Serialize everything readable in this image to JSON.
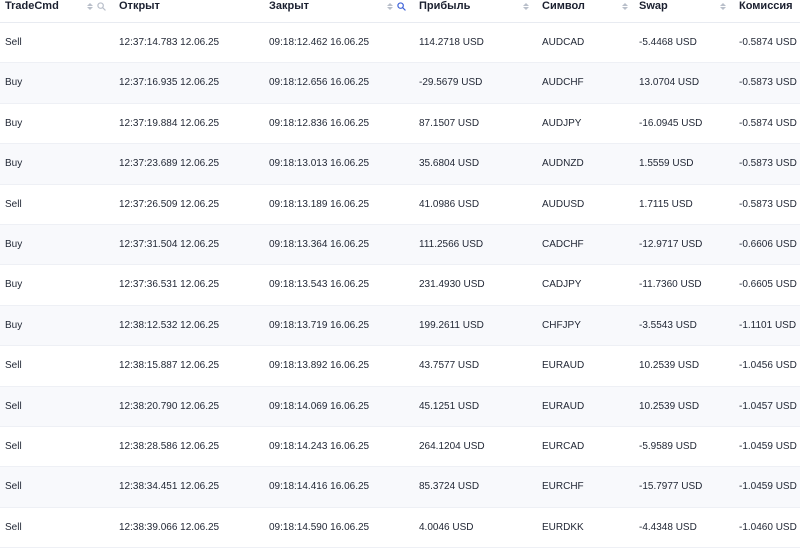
{
  "table": {
    "columns": [
      {
        "label": "TradeCmd",
        "sortable": true,
        "searchable": true,
        "search_active": false
      },
      {
        "label": "Открыт",
        "sortable": false,
        "searchable": false,
        "search_active": false
      },
      {
        "label": "Закрыт",
        "sortable": true,
        "searchable": true,
        "search_active": true
      },
      {
        "label": "Прибыль",
        "sortable": true,
        "searchable": false,
        "search_active": false
      },
      {
        "label": "Символ",
        "sortable": true,
        "searchable": false,
        "search_active": false
      },
      {
        "label": "Swap",
        "sortable": true,
        "searchable": false,
        "search_active": false
      },
      {
        "label": "Комиссия",
        "sortable": true,
        "searchable": false,
        "search_active": false
      }
    ],
    "rows": [
      [
        "Sell",
        "12:37:14.783 12.06.25",
        "09:18:12.462 16.06.25",
        "114.2718 USD",
        "AUDCAD",
        "-5.4468 USD",
        "-0.5874 USD"
      ],
      [
        "Buy",
        "12:37:16.935 12.06.25",
        "09:18:12.656 16.06.25",
        "-29.5679 USD",
        "AUDCHF",
        "13.0704 USD",
        "-0.5873 USD"
      ],
      [
        "Buy",
        "12:37:19.884 12.06.25",
        "09:18:12.836 16.06.25",
        "87.1507 USD",
        "AUDJPY",
        "-16.0945 USD",
        "-0.5874 USD"
      ],
      [
        "Buy",
        "12:37:23.689 12.06.25",
        "09:18:13.013 16.06.25",
        "35.6804 USD",
        "AUDNZD",
        "1.5559 USD",
        "-0.5873 USD"
      ],
      [
        "Sell",
        "12:37:26.509 12.06.25",
        "09:18:13.189 16.06.25",
        "41.0986 USD",
        "AUDUSD",
        "1.7115 USD",
        "-0.5873 USD"
      ],
      [
        "Buy",
        "12:37:31.504 12.06.25",
        "09:18:13.364 16.06.25",
        "111.2566 USD",
        "CADCHF",
        "-12.9717 USD",
        "-0.6606 USD"
      ],
      [
        "Buy",
        "12:37:36.531 12.06.25",
        "09:18:13.543 16.06.25",
        "231.4930 USD",
        "CADJPY",
        "-11.7360 USD",
        "-0.6605 USD"
      ],
      [
        "Buy",
        "12:38:12.532 12.06.25",
        "09:18:13.719 16.06.25",
        "199.2611 USD",
        "CHFJPY",
        "-3.5543 USD",
        "-1.1101 USD"
      ],
      [
        "Sell",
        "12:38:15.887 12.06.25",
        "09:18:13.892 16.06.25",
        "43.7577 USD",
        "EURAUD",
        "10.2539 USD",
        "-1.0456 USD"
      ],
      [
        "Sell",
        "12:38:20.790 12.06.25",
        "09:18:14.069 16.06.25",
        "45.1251 USD",
        "EURAUD",
        "10.2539 USD",
        "-1.0457 USD"
      ],
      [
        "Sell",
        "12:38:28.586 12.06.25",
        "09:18:14.243 16.06.25",
        "264.1204 USD",
        "EURCAD",
        "-5.9589 USD",
        "-1.0459 USD"
      ],
      [
        "Sell",
        "12:38:34.451 12.06.25",
        "09:18:14.416 16.06.25",
        "85.3724 USD",
        "EURCHF",
        "-15.7977 USD",
        "-1.0459 USD"
      ],
      [
        "Sell",
        "12:38:39.066 12.06.25",
        "09:18:14.590 16.06.25",
        "4.0046 USD",
        "EURDKK",
        "-4.4348 USD",
        "-1.0460 USD"
      ]
    ]
  },
  "colors": {
    "text": "#1f2533",
    "header_text": "#1b2030",
    "icon_muted": "#b9bfca",
    "icon_active": "#3f63d8",
    "row_alt": "#f8f9fc",
    "border": "#eef0f5"
  },
  "icons": {
    "sort": "sort-icon",
    "search": "search-icon"
  }
}
